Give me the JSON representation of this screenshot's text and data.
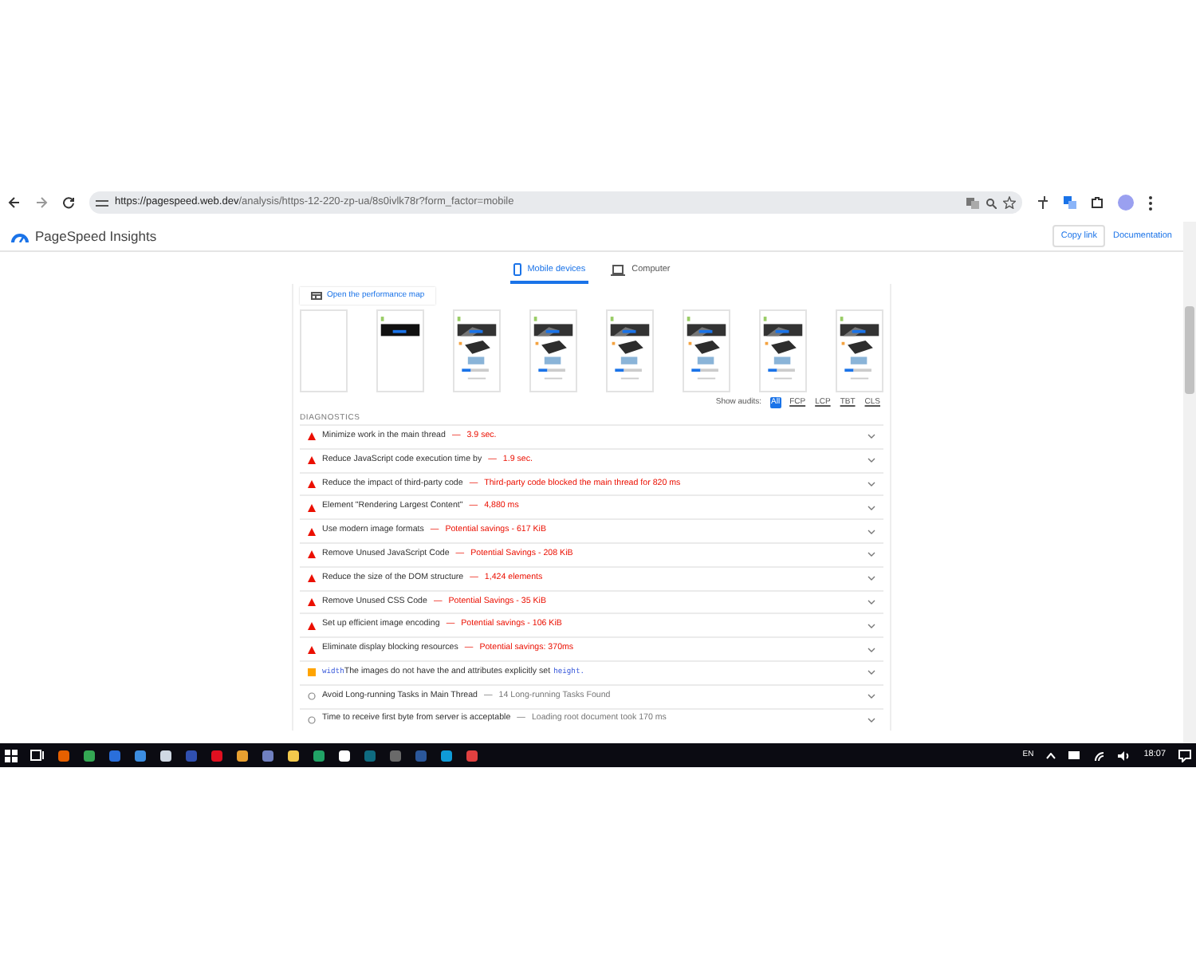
{
  "browser": {
    "url_host": "https://pagespeed.web.dev",
    "url_path": "/analysis/https-12-220-zp-ua/8s0ivlk78r?form_factor=mobile"
  },
  "header": {
    "title": "PageSpeed Insights",
    "copy_link": "Copy link",
    "documentation": "Documentation"
  },
  "tabs": [
    {
      "label": "Mobile devices",
      "selected": true
    },
    {
      "label": "Computer",
      "selected": false
    }
  ],
  "performance_map": "Open the performance map",
  "filmstrip": [
    {
      "kind": "blank"
    },
    {
      "kind": "splash"
    },
    {
      "kind": "page"
    },
    {
      "kind": "page"
    },
    {
      "kind": "page"
    },
    {
      "kind": "page"
    },
    {
      "kind": "page"
    },
    {
      "kind": "page"
    }
  ],
  "show_audits": {
    "label": "Show audits:",
    "filters": [
      {
        "label": "All",
        "selected": true
      },
      {
        "label": "FCP",
        "selected": false
      },
      {
        "label": "LCP",
        "selected": false
      },
      {
        "label": "TBT",
        "selected": false
      },
      {
        "label": "CLS",
        "selected": false
      }
    ]
  },
  "diagnostics": {
    "heading": "DIAGNOSTICS",
    "audits": [
      {
        "kind": "fail",
        "title": "Minimize work in the main thread",
        "separator": "—",
        "detail": "3.9 sec."
      },
      {
        "kind": "fail",
        "title": "Reduce JavaScript code execution time by",
        "separator": "—",
        "detail": "1.9 sec."
      },
      {
        "kind": "fail",
        "title": "Reduce the impact of third-party code",
        "separator": "—",
        "detail": "Third-party code blocked the main thread for 820 ms"
      },
      {
        "kind": "fail",
        "title": "Element \"Rendering Largest Content\"",
        "separator": "—",
        "detail": "4,880 ms"
      },
      {
        "kind": "fail",
        "title": "Use modern image formats",
        "separator": "—",
        "detail": "Potential savings - 617 KiB"
      },
      {
        "kind": "fail",
        "title": "Remove Unused JavaScript Code",
        "separator": "—",
        "detail": "Potential Savings - 208 KiB"
      },
      {
        "kind": "fail",
        "title": "Reduce the size of the DOM structure",
        "separator": "—",
        "detail": "1,424 elements"
      },
      {
        "kind": "fail",
        "title": "Remove Unused CSS Code",
        "separator": "—",
        "detail": "Potential Savings - 35 KiB"
      },
      {
        "kind": "fail",
        "title": "Set up efficient image encoding",
        "separator": "—",
        "detail": "Potential savings - 106 KiB"
      },
      {
        "kind": "fail",
        "title": "Eliminate display blocking resources",
        "separator": "—",
        "detail": "Potential savings: 370ms"
      },
      {
        "kind": "average",
        "code_before": "width",
        "title": "The images do not have the and attributes explicitly set",
        "code_after": "height."
      },
      {
        "kind": "info",
        "title": "Avoid Long-running Tasks in Main Thread",
        "separator": "—",
        "detail": "14 Long-running Tasks Found"
      },
      {
        "kind": "info",
        "title": "Time to receive first byte from server is acceptable",
        "separator": "—",
        "detail": "Loading root document took 170 ms"
      }
    ]
  },
  "taskbar": {
    "language": "EN",
    "time": "18:07"
  }
}
